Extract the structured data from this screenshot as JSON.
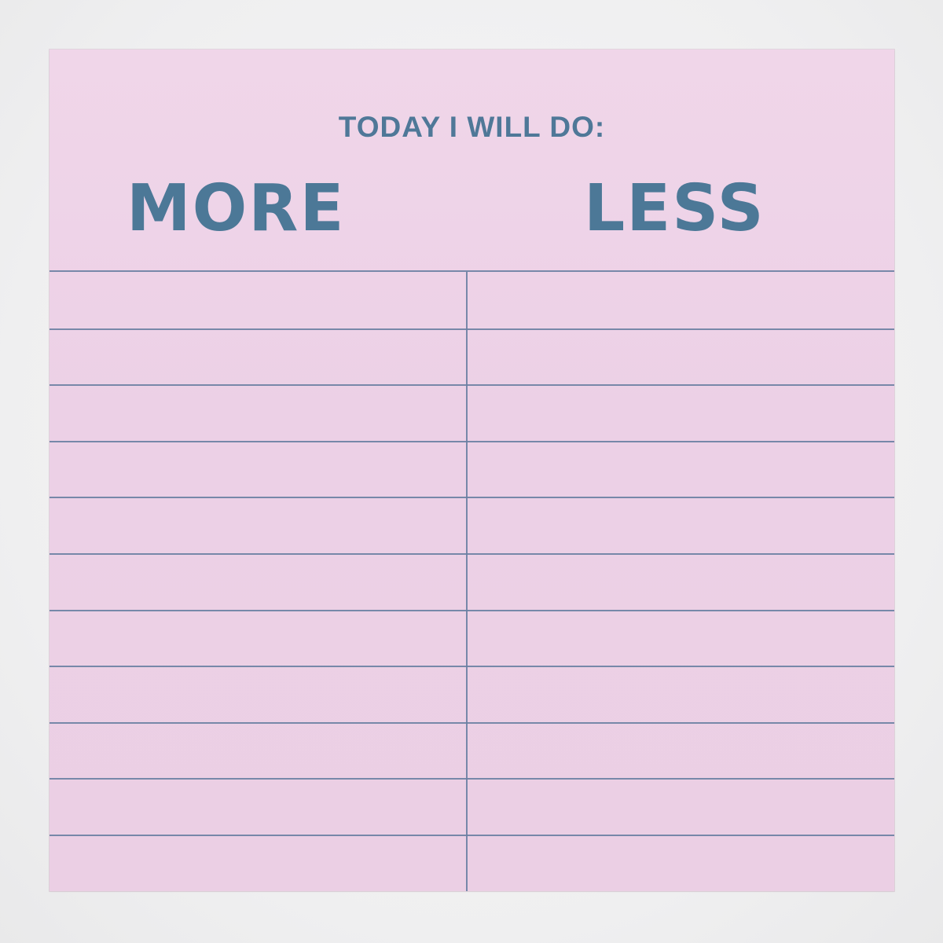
{
  "notepad": {
    "header": "TODAY I WILL DO:",
    "columns": [
      {
        "label": "MORE"
      },
      {
        "label": "LESS"
      }
    ],
    "line_count": 10
  },
  "colors": {
    "paper": "#ecd0e6",
    "ink": "#4f7898",
    "rule": "#6a7fa2",
    "background": "#f1f1f2"
  }
}
